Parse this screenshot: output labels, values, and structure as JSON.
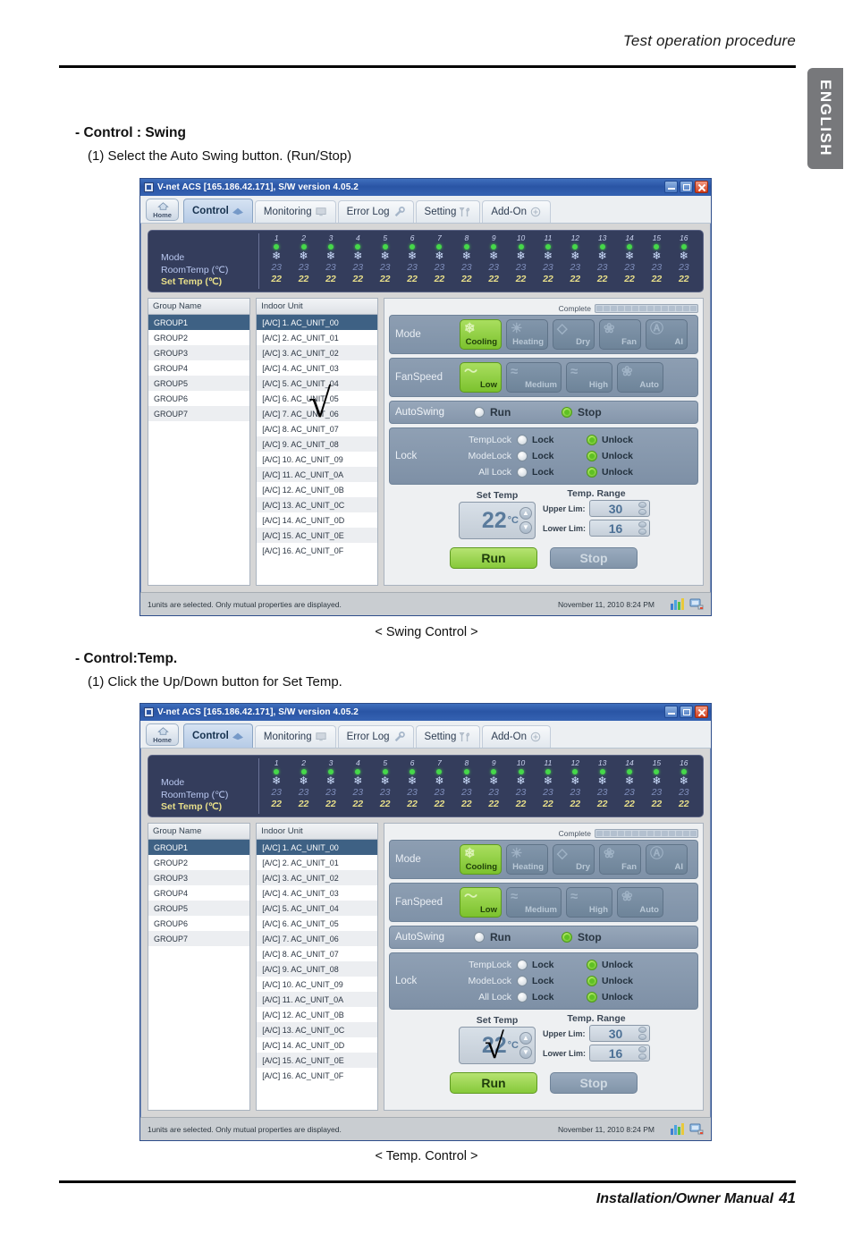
{
  "page": {
    "header_title": "Test operation procedure",
    "lang_tab": "ENGLISH",
    "footer_text": "Installation/Owner Manual",
    "page_number": "41"
  },
  "sections": [
    {
      "heading": "- Control : Swing",
      "step": "(1) Select the Auto Swing button. (Run/Stop)",
      "caption": "< Swing Control >"
    },
    {
      "heading": "- Control:Temp.",
      "step": "(1) Click the Up/Down button for Set Temp.",
      "caption": "< Temp. Control >"
    }
  ],
  "app": {
    "title": "V-net ACS [165.186.42.171],  S/W version 4.05.2",
    "home_label": "Home",
    "tabs": [
      {
        "label": "Control",
        "active": true
      },
      {
        "label": "Monitoring",
        "active": false
      },
      {
        "label": "Error Log",
        "active": false
      },
      {
        "label": "Setting",
        "active": false
      },
      {
        "label": "Add-On",
        "active": false
      }
    ],
    "status_panel": {
      "row_labels": [
        "Mode",
        "RoomTemp (℃)",
        "Set Temp  (℃)"
      ],
      "columns": [
        "1",
        "2",
        "3",
        "4",
        "5",
        "6",
        "7",
        "8",
        "9",
        "10",
        "11",
        "12",
        "13",
        "14",
        "15",
        "16"
      ],
      "room_temp": [
        "23",
        "23",
        "23",
        "23",
        "23",
        "23",
        "23",
        "23",
        "23",
        "23",
        "23",
        "23",
        "23",
        "23",
        "23",
        "23"
      ],
      "set_temp": [
        "22",
        "22",
        "22",
        "22",
        "22",
        "22",
        "22",
        "22",
        "22",
        "22",
        "22",
        "22",
        "22",
        "22",
        "22",
        "22"
      ],
      "mode_glyph": "❄"
    },
    "group_list": {
      "header": "Group Name",
      "rows": [
        "GROUP1",
        "GROUP2",
        "GROUP3",
        "GROUP4",
        "GROUP5",
        "GROUP6",
        "GROUP7"
      ],
      "selected_index": 0
    },
    "unit_list": {
      "header": "Indoor Unit",
      "rows": [
        "[A/C]  1. AC_UNIT_00",
        "[A/C]  2. AC_UNIT_01",
        "[A/C]  3. AC_UNIT_02",
        "[A/C]  4. AC_UNIT_03",
        "[A/C]  5. AC_UNIT_04",
        "[A/C]  6. AC_UNIT_05",
        "[A/C]  7. AC_UNIT_06",
        "[A/C]  8. AC_UNIT_07",
        "[A/C]  9. AC_UNIT_08",
        "[A/C]  10. AC_UNIT_09",
        "[A/C]  11. AC_UNIT_0A",
        "[A/C]  12. AC_UNIT_0B",
        "[A/C]  13. AC_UNIT_0C",
        "[A/C]  14. AC_UNIT_0D",
        "[A/C]  15. AC_UNIT_0E",
        "[A/C]  16. AC_UNIT_0F"
      ],
      "selected_index": 0
    },
    "control_panel": {
      "complete_label": "Complete",
      "mode": {
        "label": "Mode",
        "buttons": [
          {
            "label": "Cooling",
            "glyph": "❄",
            "active": true
          },
          {
            "label": "Heating",
            "glyph": "☀",
            "active": false
          },
          {
            "label": "Dry",
            "glyph": "◇",
            "active": false
          },
          {
            "label": "Fan",
            "glyph": "❀",
            "active": false
          },
          {
            "label": "AI",
            "glyph": "Ⓐ",
            "active": false
          }
        ]
      },
      "fanspeed": {
        "label": "FanSpeed",
        "buttons": [
          {
            "label": "Low",
            "glyph": "〜",
            "active": true
          },
          {
            "label": "Medium",
            "glyph": "≈",
            "active": false
          },
          {
            "label": "High",
            "glyph": "≈",
            "active": false
          },
          {
            "label": "Auto",
            "glyph": "❀",
            "active": false
          }
        ]
      },
      "autoswing": {
        "label": "AutoSwing",
        "run_label": "Run",
        "stop_label": "Stop",
        "selected": "Stop"
      },
      "lock": {
        "label": "Lock",
        "rows": [
          {
            "name": "TempLock",
            "lock_label": "Lock",
            "unlock_label": "Unlock",
            "selected": "Unlock"
          },
          {
            "name": "ModeLock",
            "lock_label": "Lock",
            "unlock_label": "Unlock",
            "selected": "Unlock"
          },
          {
            "name": "All Lock",
            "lock_label": "Lock",
            "unlock_label": "Unlock",
            "selected": "Unlock"
          }
        ]
      },
      "set_temp": {
        "caption": "Set Temp",
        "value": "22",
        "unit": "°C"
      },
      "temp_range": {
        "caption": "Temp. Range",
        "upper_label": "Upper Lim:",
        "upper_value": "30",
        "lower_label": "Lower Lim:",
        "lower_value": "16"
      },
      "run_label": "Run",
      "stop_label": "Stop"
    },
    "statusbar": {
      "message": "1units are selected. Only mutual properties are displayed.",
      "datetime": "November 11, 2010  8:24 PM"
    }
  },
  "colors": {
    "title_blue": "#2a55a5",
    "active_green": "#86c93a",
    "panel_slate": "#8596ab",
    "dark_panel": "#343d5c",
    "selection_blue": "#3e6184",
    "lang_tab_gray": "#77787b"
  }
}
